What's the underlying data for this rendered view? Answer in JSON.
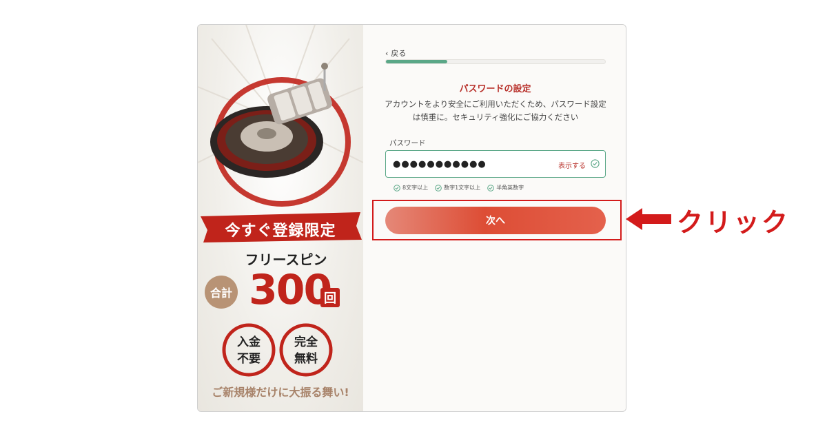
{
  "promo": {
    "banner": "今すぐ登録限定",
    "spins_label": "フリースピン",
    "total_badge": "合計",
    "count": "300",
    "count_unit": "回",
    "badge_left": "入金\n不要",
    "badge_right": "完全\n無料",
    "tagline": "ご新規様だけに大振る舞い!"
  },
  "form": {
    "back_label": "戻る",
    "progress": 0.28,
    "title": "パスワードの設定",
    "description": "アカウントをより安全にご利用いただくため、パスワード設定は慎重に。セキュリティ強化にご協力ください",
    "password_label": "パスワード",
    "password_value": "●●●●●●●●●●●",
    "show_label": "表示する",
    "rules": [
      "8文字以上",
      "数字1文字以上",
      "半角英数字"
    ],
    "next_label": "次へ"
  },
  "annotation": {
    "click_label": "クリック"
  },
  "colors": {
    "accent_red": "#c0241b",
    "valid_green": "#5aa787",
    "annotation_red": "#d31b1b"
  },
  "icons": [
    "chevron-left-icon",
    "check-circle-icon",
    "slot-roulette-illustration",
    "arrow-left-icon"
  ]
}
